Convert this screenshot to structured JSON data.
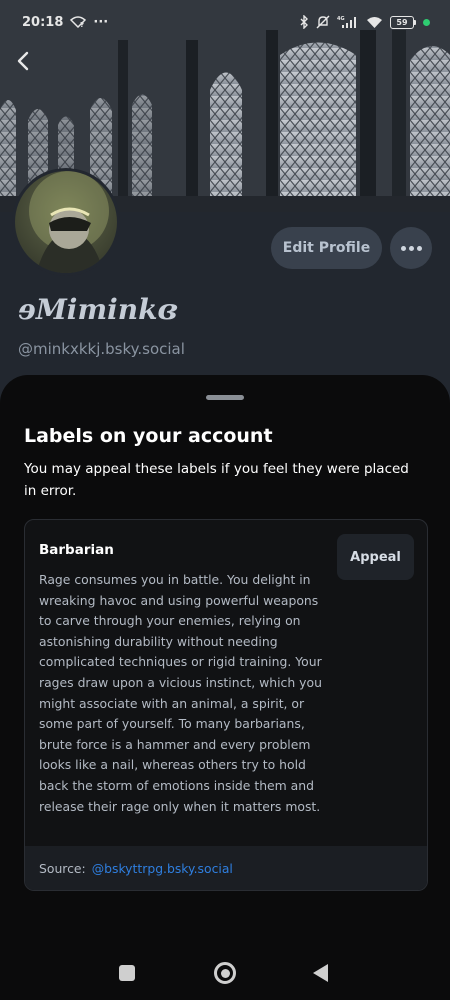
{
  "status_bar": {
    "time": "20:18",
    "notification_glyph": "···",
    "battery_level": "59",
    "icons": [
      "wifi-off-icon",
      "bluetooth-icon",
      "mute-icon",
      "signal-icon",
      "wifi-icon",
      "battery-icon"
    ]
  },
  "profile": {
    "display_name": "ɘMiminkɞ",
    "handle": "@minkxkkj.bsky.social",
    "edit_profile_label": "Edit Profile"
  },
  "sheet": {
    "title": "Labels on your account",
    "subtitle": "You may appeal these labels if you feel they were placed in error.",
    "label": {
      "name": "Barbarian",
      "appeal_label": "Appeal",
      "description": "Rage consumes you in battle. You delight in wreaking havoc and using powerful weapons to carve through your enemies, relying on astonishing durability without needing complicated techniques or rigid training. Your rages draw upon a vicious instinct, which you might associate with an animal, a spirit, or some part of yourself. To many barbarians, brute force is a hammer and every problem looks like a nail, whereas others try to hold back the storm of emotions inside them and release their rage only when it matters most.",
      "source_prefix": "Source:",
      "source_link": "@bskyttrpg.bsky.social"
    }
  },
  "colors": {
    "sheet_bg": "#0b0b0c",
    "link": "#2f7fe0",
    "battery_indicator": "#2ecc71"
  }
}
